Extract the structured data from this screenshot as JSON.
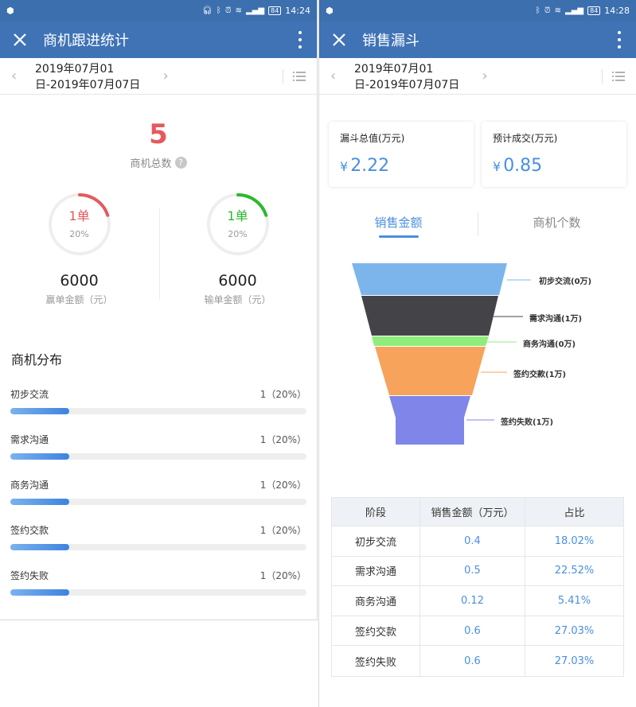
{
  "left": {
    "status": {
      "time": "14:24",
      "battery": "84"
    },
    "appbar": {
      "title": "商机跟进统计"
    },
    "datebar": {
      "range": "2019年07月01日-2019年07月07日"
    },
    "total": {
      "value": "5",
      "label": "商机总数"
    },
    "won": {
      "count": "1单",
      "percent": "20%",
      "percent_value": 0.2,
      "amount": "6000",
      "label": "赢单金额（元）",
      "color": "#e5595d"
    },
    "lost": {
      "count": "1单",
      "percent": "20%",
      "percent_value": 0.2,
      "amount": "6000",
      "label": "输单金额（元）",
      "color": "#2db82d"
    },
    "distribution": {
      "title": "商机分布",
      "items": [
        {
          "label": "初步交流",
          "value": "1（20%）",
          "fraction": 0.2
        },
        {
          "label": "需求沟通",
          "value": "1（20%）",
          "fraction": 0.2
        },
        {
          "label": "商务沟通",
          "value": "1（20%）",
          "fraction": 0.2
        },
        {
          "label": "签约交款",
          "value": "1（20%）",
          "fraction": 0.2
        },
        {
          "label": "签约失败",
          "value": "1（20%）",
          "fraction": 0.2
        }
      ]
    }
  },
  "right": {
    "status": {
      "time": "14:28",
      "battery": "84"
    },
    "appbar": {
      "title": "销售漏斗"
    },
    "datebar": {
      "range": "2019年07月01日-2019年07月07日"
    },
    "cards": [
      {
        "label": "漏斗总值(万元)",
        "currency": "¥",
        "value": "2.22"
      },
      {
        "label": "预计成交(万元)",
        "currency": "¥",
        "value": "0.85"
      }
    ],
    "tabs": [
      {
        "label": "销售金额",
        "active": true
      },
      {
        "label": "商机个数",
        "active": false
      }
    ],
    "funnel": {
      "stages": [
        {
          "label": "初步交流(0万)",
          "color": "#7cb5ec"
        },
        {
          "label": "需求沟通(1万)",
          "color": "#434348"
        },
        {
          "label": "商务沟通(0万)",
          "color": "#90ed7d"
        },
        {
          "label": "签约交款(1万)",
          "color": "#f7a35c"
        },
        {
          "label": "签约失败(1万)",
          "color": "#8085e9"
        }
      ]
    },
    "table": {
      "headers": [
        "阶段",
        "销售金额（万元）",
        "占比"
      ],
      "rows": [
        [
          "初步交流",
          "0.4",
          "18.02%"
        ],
        [
          "需求沟通",
          "0.5",
          "22.52%"
        ],
        [
          "商务沟通",
          "0.12",
          "5.41%"
        ],
        [
          "签约交款",
          "0.6",
          "27.03%"
        ],
        [
          "签约失败",
          "0.6",
          "27.03%"
        ]
      ]
    }
  },
  "colors": {
    "appbar": "#3f73b5",
    "accent": "#4a8fe0",
    "won": "#e5595d",
    "lost": "#2db82d"
  },
  "icons": [
    "close-icon",
    "more-vert-icon",
    "chevron-left-icon",
    "chevron-right-icon",
    "list-icon",
    "help-icon"
  ]
}
